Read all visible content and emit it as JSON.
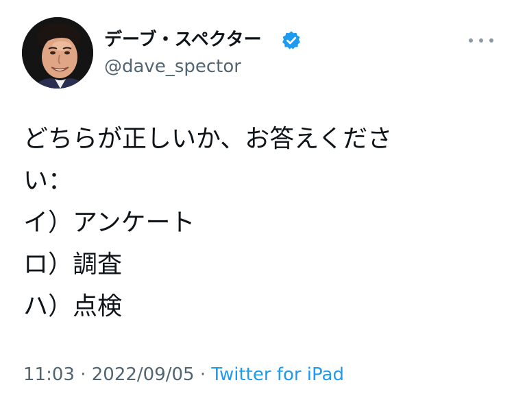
{
  "author": {
    "display_name": "デーブ・スペクター",
    "handle": "@dave_spector",
    "verified_icon": "verified-badge-icon",
    "avatar_icon": "profile-photo"
  },
  "tweet": {
    "lines": [
      "どちらが正しいか、お答えくださ",
      "い：",
      "イ）アンケート",
      "ロ）調査",
      "ハ）点検"
    ]
  },
  "meta": {
    "time": "11:03",
    "separator": " · ",
    "date": "2022/09/05",
    "source": "Twitter for iPad"
  },
  "colors": {
    "text": "#0f1419",
    "secondary": "#536471",
    "accent": "#1d9bf0"
  }
}
